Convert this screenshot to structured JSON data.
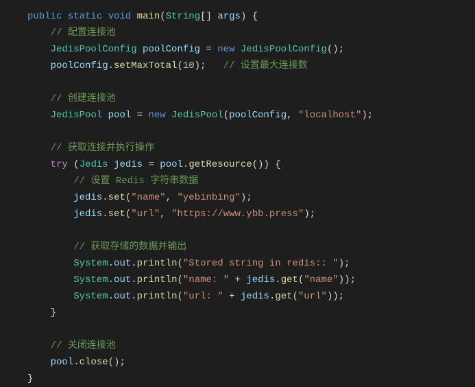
{
  "code": {
    "l1": {
      "public": "public",
      "static": "static",
      "void": "void",
      "main": "main",
      "stringArr": "String",
      "args": "args"
    },
    "l2": {
      "comment": "// 配置连接池"
    },
    "l3": {
      "type": "JedisPoolConfig",
      "var": "poolConfig",
      "new": "new",
      "ctor": "JedisPoolConfig"
    },
    "l4": {
      "var": "poolConfig",
      "method": "setMaxTotal",
      "arg": "10",
      "comment": "// 设置最大连接数"
    },
    "l5": {
      "comment": "// 创建连接池"
    },
    "l6": {
      "type": "JedisPool",
      "var": "pool",
      "new": "new",
      "ctor": "JedisPool",
      "arg1": "poolConfig",
      "arg2": "\"localhost\""
    },
    "l7": {
      "comment": "// 获取连接并执行操作"
    },
    "l8": {
      "try": "try",
      "type": "Jedis",
      "var": "jedis",
      "pool": "pool",
      "method": "getResource"
    },
    "l9": {
      "comment": "// 设置 Redis 字符串数据"
    },
    "l10": {
      "var": "jedis",
      "method": "set",
      "arg1": "\"name\"",
      "arg2": "\"yebinbing\""
    },
    "l11": {
      "var": "jedis",
      "method": "set",
      "arg1": "\"url\"",
      "arg2": "\"https://www.ybb.press\""
    },
    "l12": {
      "comment": "// 获取存储的数据并输出"
    },
    "l13": {
      "sys": "System",
      "out": "out",
      "method": "println",
      "arg": "\"Stored string in redis:: \""
    },
    "l14": {
      "sys": "System",
      "out": "out",
      "method": "println",
      "arg1": "\"name: \"",
      "jedis": "jedis",
      "get": "get",
      "key": "\"name\""
    },
    "l15": {
      "sys": "System",
      "out": "out",
      "method": "println",
      "arg1": "\"url: \"",
      "jedis": "jedis",
      "get": "get",
      "key": "\"url\""
    },
    "l16": {
      "comment": "// 关闭连接池"
    },
    "l17": {
      "var": "pool",
      "method": "close"
    }
  }
}
